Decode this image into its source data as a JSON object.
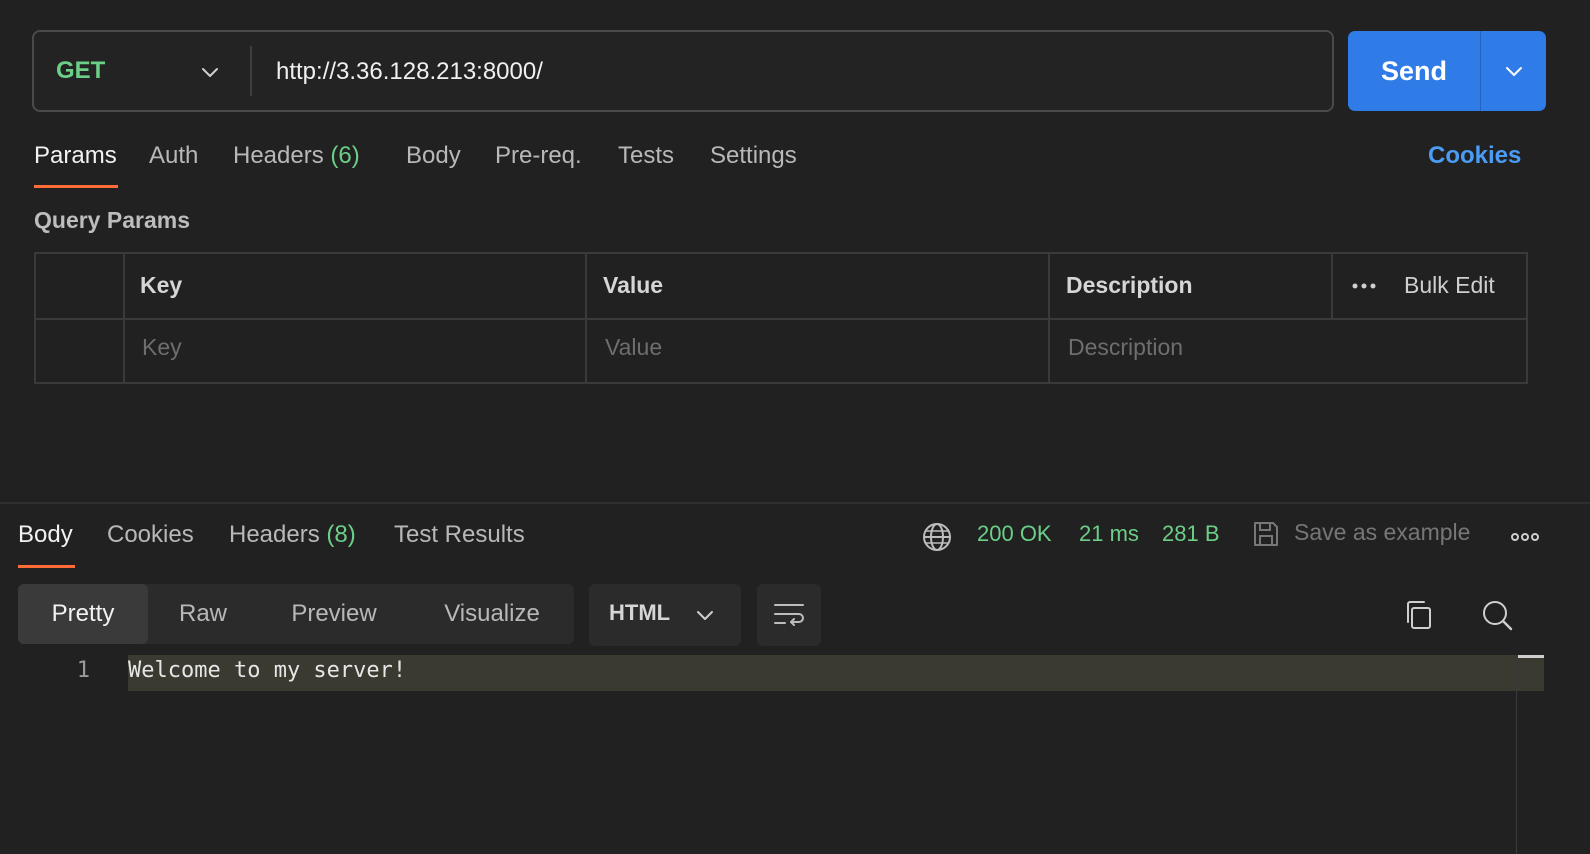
{
  "request": {
    "method": "GET",
    "url": "http://3.36.128.213:8000/",
    "send_label": "Send"
  },
  "request_tabs": {
    "params": "Params",
    "auth": "Auth",
    "headers": "Headers",
    "headers_count": "(6)",
    "body": "Body",
    "prereq": "Pre-req.",
    "tests": "Tests",
    "settings": "Settings",
    "cookies": "Cookies"
  },
  "params": {
    "section_title": "Query Params",
    "headers": {
      "key": "Key",
      "value": "Value",
      "description": "Description",
      "bulk_edit": "Bulk Edit"
    },
    "placeholders": {
      "key": "Key",
      "value": "Value",
      "description": "Description"
    }
  },
  "response_tabs": {
    "body": "Body",
    "cookies": "Cookies",
    "headers": "Headers",
    "headers_count": "(8)",
    "test_results": "Test Results"
  },
  "response_status": {
    "status": "200 OK",
    "time": "21 ms",
    "size": "281 B",
    "save_example": "Save as example"
  },
  "view_modes": {
    "pretty": "Pretty",
    "raw": "Raw",
    "preview": "Preview",
    "visualize": "Visualize",
    "format": "HTML"
  },
  "response_body": {
    "line_number": "1",
    "line_text": "Welcome to my server!"
  },
  "colors": {
    "accent_orange": "#ff6c37",
    "send_blue": "#2f7be8",
    "success_green": "#6bcf88",
    "link_blue": "#4a9cf5"
  }
}
